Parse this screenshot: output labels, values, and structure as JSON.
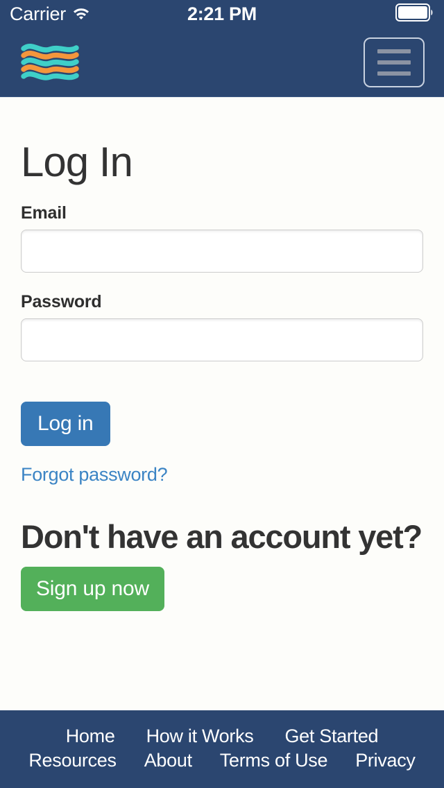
{
  "statusbar": {
    "carrier": "Carrier",
    "time": "2:21 PM",
    "wifi_icon": "wifi-icon",
    "battery_icon": "battery-full-icon"
  },
  "header": {
    "logo_icon": "wavy-flag-logo",
    "menu_icon": "hamburger-menu-icon",
    "background_color": "#2b4670",
    "logo_teal": "#3fcfc8",
    "logo_orange": "#f4963c"
  },
  "main": {
    "title": "Log In",
    "email": {
      "label": "Email",
      "value": "",
      "placeholder": ""
    },
    "password": {
      "label": "Password",
      "value": "",
      "placeholder": ""
    },
    "login_button": "Log in",
    "forgot_link": "Forgot password?",
    "signup_title": "Don't have an account yet?",
    "signup_button": "Sign up now",
    "login_button_color": "#3778b5",
    "signup_button_color": "#53b05a",
    "link_color": "#3b84c4"
  },
  "footer": {
    "row1": [
      {
        "label": "Home"
      },
      {
        "label": "How it Works"
      },
      {
        "label": "Get Started"
      }
    ],
    "row2": [
      {
        "label": "Resources"
      },
      {
        "label": "About"
      },
      {
        "label": "Terms of Use"
      },
      {
        "label": "Privacy"
      }
    ],
    "background_color": "#2b4670"
  }
}
